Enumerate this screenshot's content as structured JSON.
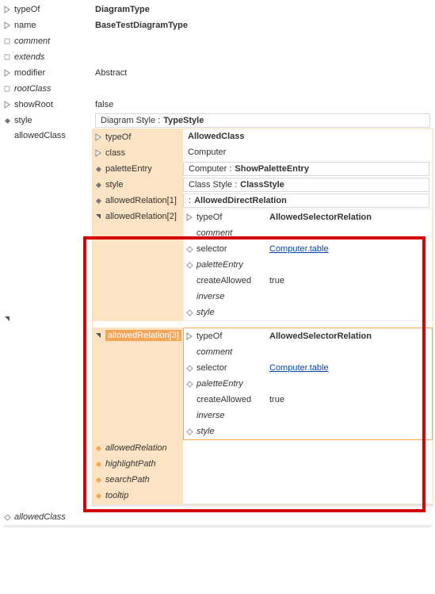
{
  "root_props": {
    "typeOf": "DiagramType",
    "name": "BaseTestDiagramType",
    "comment_label": "comment",
    "extends_label": "extends",
    "modifier_label": "modifier",
    "modifier_value": "Abstract",
    "rootclass_label": "rootClass",
    "showroot_label": "showRoot",
    "showroot_value": "false",
    "style_label": "style",
    "style_prefix": "Diagram Style  :  ",
    "style_value": "TypeStyle",
    "allowedclass_label": "allowedClass",
    "allowedclass_footer": "allowedClass"
  },
  "allowed_class": {
    "typeOf": "AllowedClass",
    "class": "Computer",
    "palette_label": "paletteEntry",
    "palette_prefix": "Computer  :  ",
    "palette_value": "ShowPaletteEntry",
    "style_label": "style",
    "style_prefix": "Class Style  :  ",
    "style_value": "ClassStyle",
    "ar1_label": "allowedRelation[1]",
    "ar1_prefix": "  :  ",
    "ar1_value": "AllowedDirectRelation",
    "ar2_label": "allowedRelation[2]",
    "ar3_label": "allowedRelation[3]",
    "addrel_label": "allowedRelation",
    "highlight_label": "highlightPath",
    "search_label": "searchPath",
    "tooltip_label": "tooltip"
  },
  "relation_block": {
    "typeOf_label": "typeOf",
    "typeOf_value": "AllowedSelectorRelation",
    "comment_label": "comment",
    "selector_label": "selector",
    "selector_value": "Computer.table",
    "palette_label": "paletteEntry",
    "create_label": "createAllowed",
    "create_value": "true",
    "inverse_label": "inverse",
    "style_label": "style"
  }
}
